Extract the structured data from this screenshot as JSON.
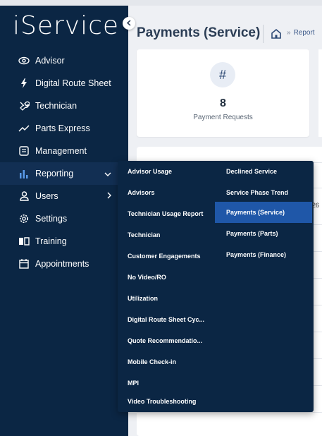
{
  "app": {
    "logo": "iService"
  },
  "sidebar": {
    "items": [
      {
        "label": "Advisor",
        "icon": "eye-icon"
      },
      {
        "label": "Digital Route Sheet",
        "icon": "lightning-icon"
      },
      {
        "label": "Technician",
        "icon": "wrench-icon"
      },
      {
        "label": "Parts Express",
        "icon": "trend-line-icon"
      },
      {
        "label": "Management",
        "icon": "document-icon"
      },
      {
        "label": "Reporting",
        "icon": "bar-chart-icon"
      },
      {
        "label": "Users",
        "icon": "user-icon"
      },
      {
        "label": "Settings",
        "icon": "gear-icon"
      },
      {
        "label": "Training",
        "icon": "book-icon"
      },
      {
        "label": "Appointments",
        "icon": "calendar-icon"
      }
    ]
  },
  "header": {
    "title": "Payments (Service)",
    "breadcrumb_sep": "»",
    "breadcrumb": "Report"
  },
  "stat_card": {
    "icon_glyph": "#",
    "count": "8",
    "label": "Payment Requests"
  },
  "table_fragment": {
    "text": "26"
  },
  "reporting_menu": {
    "col1": [
      "Advisor Usage",
      "Advisors",
      "Technician Usage Report",
      "Technician",
      "Customer Engagements",
      "No Video/RO",
      "Utilization",
      "Digital Route Sheet Cyc...",
      "Quote Recommendatio...",
      "Mobile Check-in",
      "MPI",
      "Video Troubleshooting"
    ],
    "col2": [
      "Declined Service",
      "Service Phase Trend",
      "Payments (Service)",
      "Payments (Parts)",
      "Payments (Finance)"
    ],
    "selected": "Payments (Service)"
  },
  "colors": {
    "sidebar_bg": "#0b2644",
    "menu_selected": "#1f57a8",
    "title_text": "#2b3d55"
  }
}
